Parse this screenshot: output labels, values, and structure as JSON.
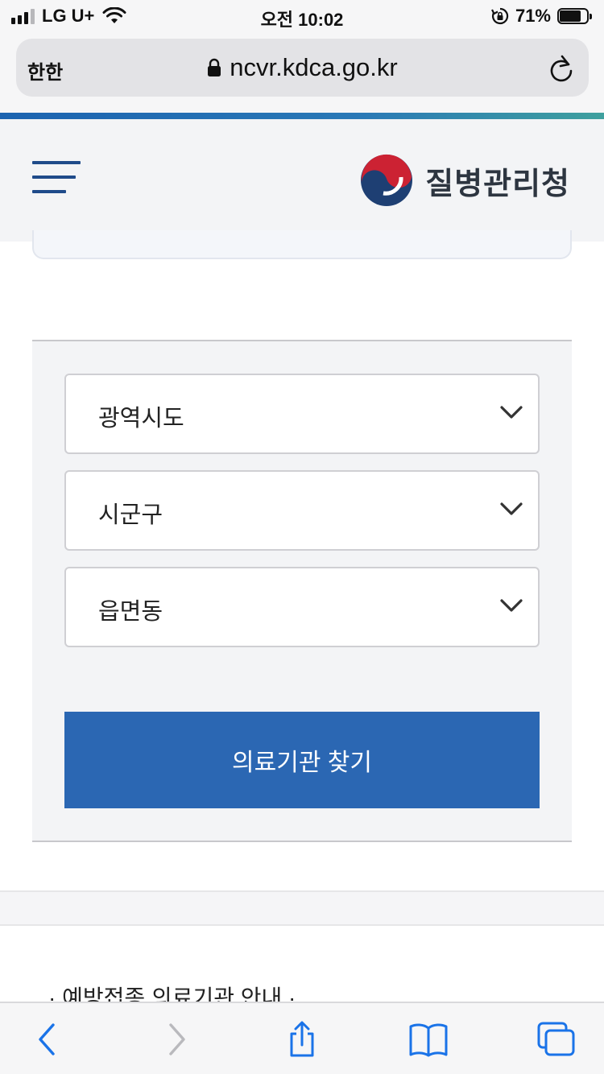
{
  "status_bar": {
    "carrier": "LG U+",
    "time": "오전 10:02",
    "battery": "71%"
  },
  "browser": {
    "reader_label": "한한",
    "url": "ncvr.kdca.go.kr"
  },
  "header": {
    "org_name": "질병관리청"
  },
  "search": {
    "province_label": "광역시도",
    "city_label": "시군구",
    "town_label": "읍면동",
    "find_button": "의료기관 찾기"
  },
  "footer": {
    "partial_text": "· 예방접종 의료기관 안내 · ..."
  },
  "colors": {
    "primary": "#2b67b3",
    "ios_blue": "#1a73e8",
    "header_bg": "#f3f4f6"
  },
  "icons": [
    "signal-icon",
    "wifi-icon",
    "rotation-lock-icon",
    "battery-icon",
    "lock-icon",
    "reload-icon",
    "hamburger-icon",
    "kdca-logo",
    "chevron-down-icon",
    "back-icon",
    "forward-icon",
    "share-icon",
    "bookmarks-icon",
    "tabs-icon"
  ]
}
